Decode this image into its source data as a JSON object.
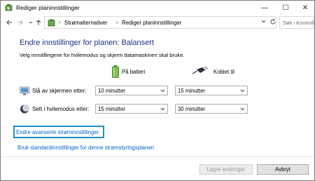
{
  "window": {
    "title": "Rediger planinnstillinger",
    "controls": {
      "minimize": "—",
      "maximize": "☐",
      "close": "✕"
    }
  },
  "address_bar": {
    "breadcrumb": [
      "Strømalternativer",
      "Rediger planinnstillinger"
    ],
    "separator": "›",
    "search_placeholder": "Søk i Kontrollpanel"
  },
  "main": {
    "heading": "Endre innstillinger for planen: Balansert",
    "subtitle": "Velg innstillingene for hvilemodus og skjerm datamaskinen skal bruke.",
    "columns": {
      "battery": "På batteri",
      "plugged_in": "Koblet til"
    },
    "rows": [
      {
        "label": "Slå av skjermen etter:",
        "battery_value": "10 minutter",
        "plugged_value": "15 minutter"
      },
      {
        "label": "Sett i hvilemodus etter:",
        "battery_value": "15 minutter",
        "plugged_value": "30 minutter"
      }
    ],
    "links": {
      "advanced": "Endre avanserte strøminnstillinger",
      "restore_defaults": "Bruk standardinnstillinger for denne strømstyringsplanen"
    }
  },
  "footer": {
    "save_label": "Lagre endringer",
    "cancel_label": "Avbryt"
  },
  "colors": {
    "heading": "#1e3287",
    "link": "#0066cc",
    "focus_ring": "#1e8fc6"
  }
}
